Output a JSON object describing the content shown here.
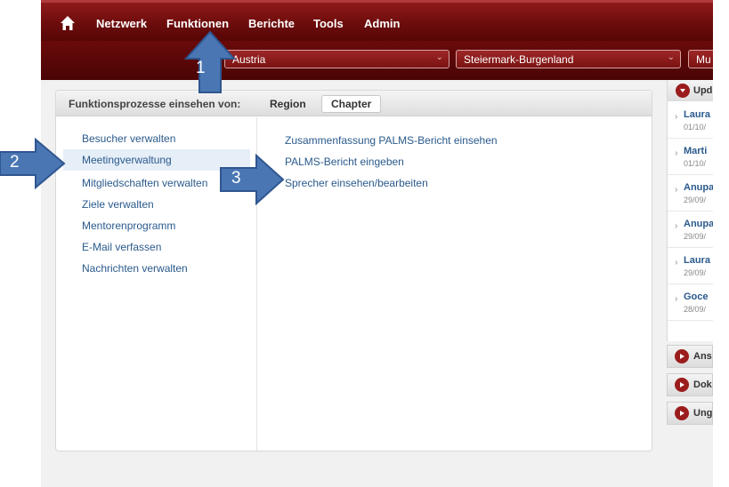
{
  "nav": {
    "items": [
      "Netzwerk",
      "Funktionen",
      "Berichte",
      "Tools",
      "Admin"
    ]
  },
  "filters": {
    "country": "Austria",
    "region": "Steiermark-Burgenland",
    "chapter": "Mu"
  },
  "panel": {
    "title": "Funktionsprozesse einsehen von:",
    "tab_region": "Region",
    "tab_chapter": "Chapter",
    "left_items": [
      "Besucher verwalten",
      "Meetingverwaltung",
      "Mitgliedschaften verwalten",
      "Ziele verwalten",
      "Mentorenprogramm",
      "E-Mail verfassen",
      "Nachrichten verwalten"
    ],
    "right_items": [
      "Zusammenfassung PALMS-Bericht einsehen",
      "PALMS-Bericht eingeben",
      "Sprecher einsehen/bearbeiten"
    ]
  },
  "sidebar": {
    "updates_label": "Upd",
    "updates": [
      {
        "name": "Laura",
        "date": "01/10/"
      },
      {
        "name": "Marti",
        "date": "01/10/"
      },
      {
        "name": "Anupa",
        "date": "29/09/"
      },
      {
        "name": "Anupa",
        "date": "29/09/"
      },
      {
        "name": "Laura",
        "date": "29/09/"
      },
      {
        "name": "Goce",
        "date": "28/09/"
      }
    ],
    "boxes": [
      "Ans",
      "Dok",
      "Ung"
    ]
  },
  "annotations": [
    "1",
    "2",
    "3"
  ],
  "colors": {
    "brand": "#7b1212",
    "link": "#2a5a8c",
    "annotation": "#4a77b4"
  }
}
